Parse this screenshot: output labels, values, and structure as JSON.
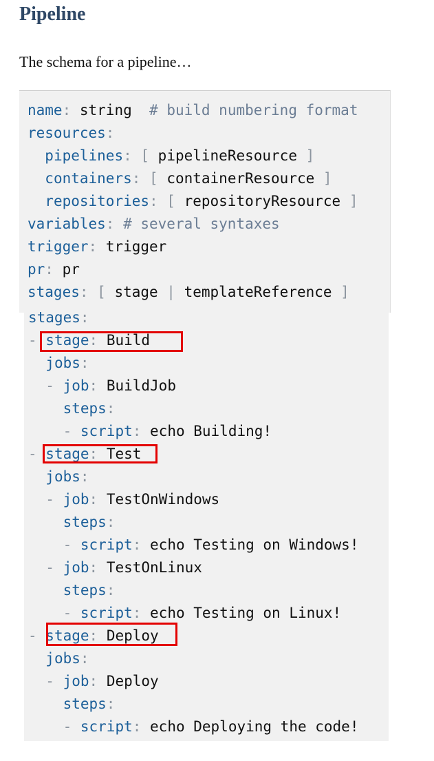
{
  "heading": "Pipeline",
  "intro": "The schema for a pipeline…",
  "schema": {
    "name_key": "name",
    "name_value": "string",
    "name_comment": "# build numbering format",
    "resources_key": "resources",
    "pipelines_key": "pipelines",
    "pipelines_value": "pipelineResource",
    "containers_key": "containers",
    "containers_value": "containerResource",
    "repositories_key": "repositories",
    "repositories_value": "repositoryResource",
    "variables_key": "variables",
    "variables_comment": "# several syntaxes",
    "trigger_key": "trigger",
    "trigger_value": "trigger",
    "pr_key": "pr",
    "pr_value": "pr",
    "stages_key": "stages",
    "stages_value_1": "stage",
    "stages_value_2": "templateReference"
  },
  "example": {
    "stages_key": "stages",
    "stage_key": "stage",
    "jobs_key": "jobs",
    "job_key": "job",
    "steps_key": "steps",
    "script_key": "script",
    "stage1_name": "Build",
    "job1_name": "BuildJob",
    "script1": "echo Building!",
    "stage2_name": "Test",
    "job2_name": "TestOnWindows",
    "script2": "echo Testing on Windows!",
    "job3_name": "TestOnLinux",
    "script3": "echo Testing on Linux!",
    "stage3_name": "Deploy",
    "job4_name": "Deploy",
    "script4": "echo Deploying the code!"
  },
  "colors": {
    "key": "#1c5f99",
    "punctuation": "#8c959f",
    "comment": "#6b7d94",
    "highlight_border": "#e30000",
    "heading": "#2f4866",
    "code_background": "#f1f1f1"
  }
}
